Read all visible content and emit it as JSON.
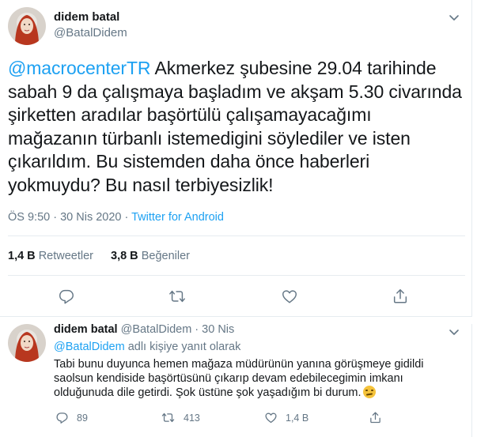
{
  "tweet": {
    "author_name": "didem batal",
    "author_handle": "@BatalDidem",
    "mention": "@macrocenterTR",
    "text_line1_rest": " Akmerkez şubesine 29.04 tarihinde",
    "text_line2": "sabah 9 da çalışmaya başladım ve akşam 5.30 civarında",
    "text_line3": "şirketten aradılar başörtülü çalışamayacağımı",
    "text_line4": "mağazanın  türbanlı istemedigini söylediler ve isten",
    "text_line5": "çıkarıldım. Bu sistemden daha önce haberleri",
    "text_line6": "yokmuydu? Bu nasıl terbiyesizlik!",
    "time": "ÖS 9:50",
    "dot": " · ",
    "date": "30 Nis 2020",
    "source": "Twitter for Android",
    "retweets_count": "1,4 B",
    "retweets_label": "Retweetler",
    "likes_count": "3,8 B",
    "likes_label": "Beğeniler"
  },
  "icons": {
    "caret": "chevron-down-icon",
    "reply": "reply-icon",
    "retweet": "retweet-icon",
    "like": "heart-icon",
    "share": "share-icon",
    "emoji": "unamused-face-emoji"
  },
  "reply": {
    "author_name": "didem batal",
    "meta": " @BatalDidem · 30 Nis",
    "replying_mention": "@BatalDidem",
    "replying_suffix": " adlı kişiye yanıt olarak",
    "line1": "Tabi bunu duyunca hemen mağaza müdürünün yanına görüşmeye gidildi",
    "line2": "saolsun kendiside başörtüsünü çıkarıp devam edebilecegimin imkanı",
    "line3": "olduğunuda dile getirdi.  Şok üstüne şok yaşadığım bi durum.",
    "replies": "89",
    "retweets": "413",
    "likes": "1,4 B"
  },
  "colors": {
    "accent": "#1da1f2",
    "muted": "#657786",
    "text": "#14171a",
    "border": "#e6ecf0"
  }
}
